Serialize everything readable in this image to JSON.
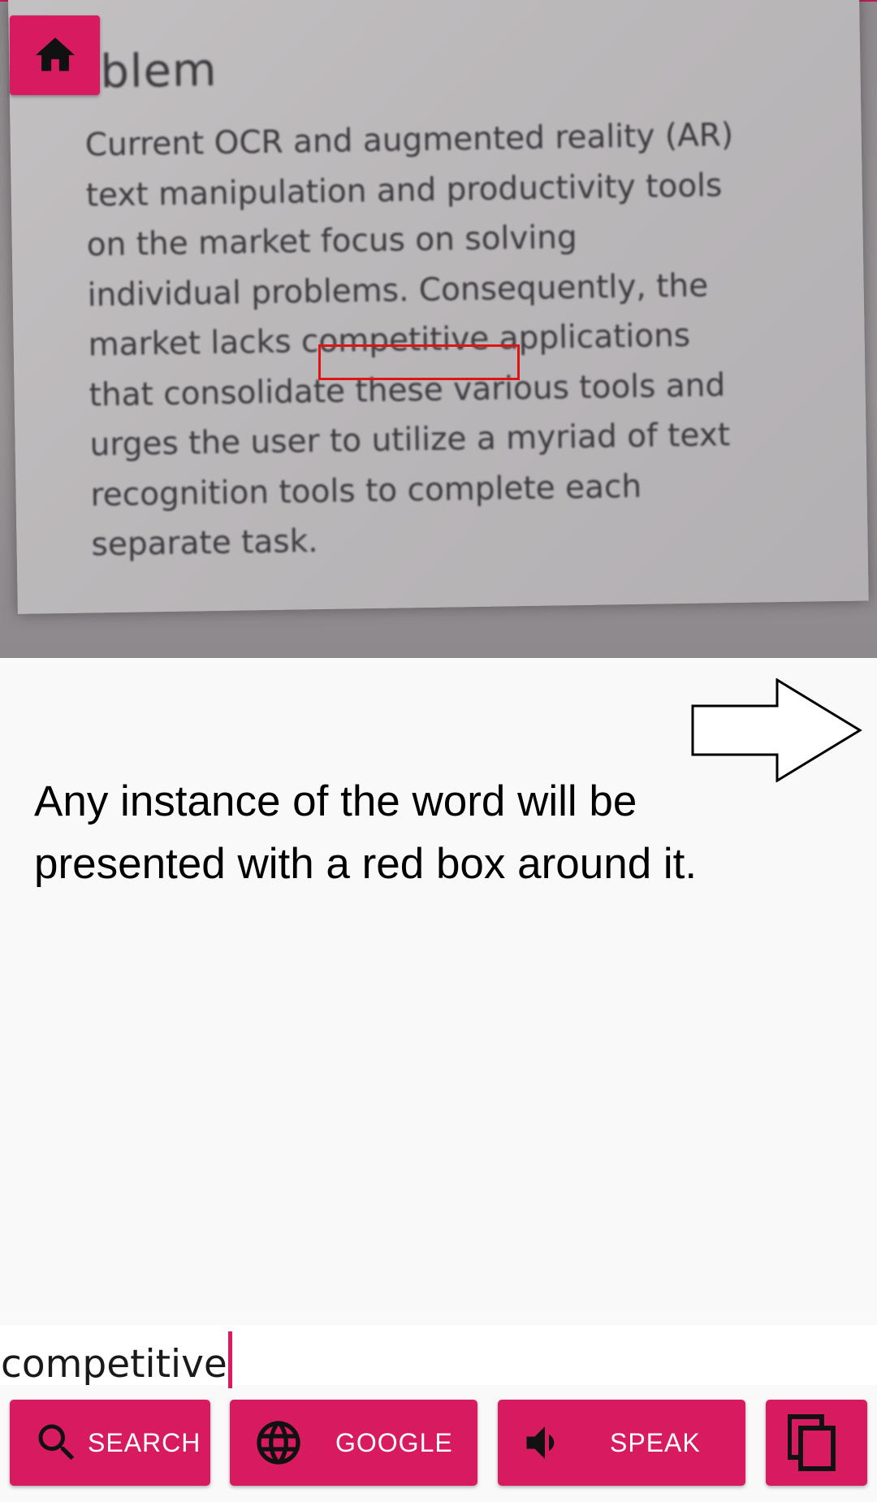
{
  "camera": {
    "title_fragment": "blem",
    "body_lines": [
      "Current OCR and augmented reality (AR)",
      "text manipulation and productivity tools",
      "on the market focus on solving",
      "individual problems.  Consequently, the",
      "market lacks competitive applications",
      "that consolidate these various tools and",
      "urges the user to utilize a myriad of text",
      "recognition tools to complete each",
      "separate task."
    ],
    "highlighted_word": "competitive"
  },
  "home_button": {
    "icon": "home-icon"
  },
  "annotation": {
    "text": "Any instance of the word will be presented with a red box around it.",
    "arrow_icon": "right-arrow-icon"
  },
  "search_field": {
    "value": "competitive"
  },
  "buttons": [
    {
      "label": "SEARCH",
      "icon": "search-icon"
    },
    {
      "label": "GOOGLE",
      "icon": "globe-icon"
    },
    {
      "label": "SPEAK",
      "icon": "speaker-icon"
    },
    {
      "label": "",
      "icon": "copy-icon"
    }
  ],
  "colors": {
    "accent": "#d81b60",
    "highlight_box": "#e01414"
  }
}
